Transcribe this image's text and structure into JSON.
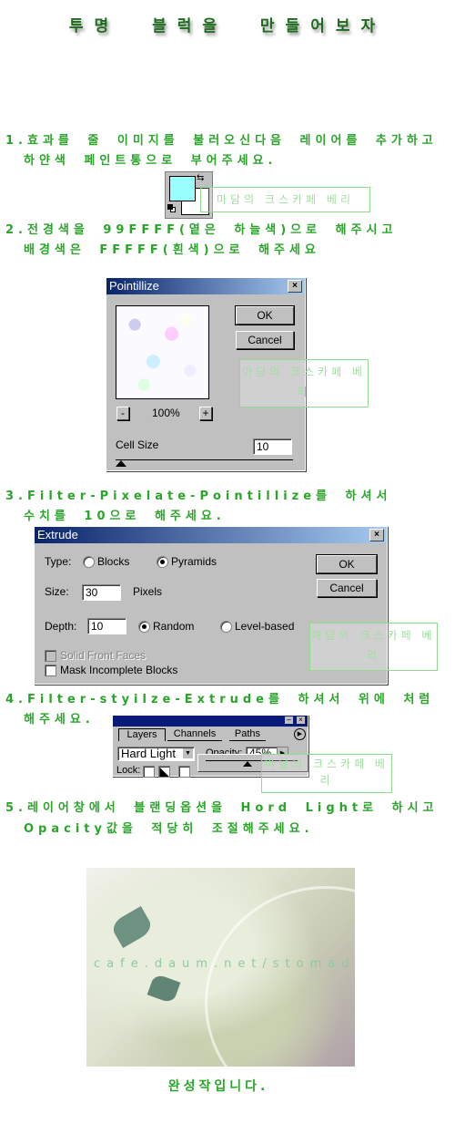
{
  "title": "투명 블럭을 만들어보자",
  "watermark": "마담의 크스카페 베리",
  "steps": [
    {
      "line1": "1.효과를 줄 이미지를 불러오신다음 레이어를 추가하고",
      "line2": "하얀색 페인트통으로 부어주세요."
    },
    {
      "line1": "2.전경색을 99FFFF(옅은 하늘색)으로 해주시고",
      "line2": "배경색은 FFFFF(흰색)으로 해주세요"
    },
    {
      "line1": "3.Filter-Pixelate-Pointillize를 하셔서",
      "line2": "수치를 10으로 해주세요."
    },
    {
      "line1": "4.Filter-styilze-Extrude를 하셔서 위에 처럼",
      "line2": "해주세요."
    },
    {
      "line1": "5.레이어창에서 블랜딩옵션을 Hord Light로 하시고",
      "line2": "Opacity값을 적당히 조절해주세요."
    }
  ],
  "colors": {
    "foreground": "#99FFFF",
    "background": "#FFFFFF",
    "text": "#2AA52A",
    "title": "#1E6B1E"
  },
  "pointillize": {
    "title": "Pointillize",
    "ok": "OK",
    "cancel": "Cancel",
    "zoom": "100%",
    "zoom_out": "-",
    "zoom_in": "+",
    "cell_size_label": "Cell Size",
    "cell_size": "10"
  },
  "extrude": {
    "title": "Extrude",
    "type_label": "Type:",
    "type_blocks": "Blocks",
    "type_pyramids": "Pyramids",
    "type_selected": "Pyramids",
    "size_label": "Size:",
    "size": "30",
    "size_unit": "Pixels",
    "depth_label": "Depth:",
    "depth": "10",
    "depth_random": "Random",
    "depth_level": "Level-based",
    "depth_selected": "Random",
    "solid_front": "Solid Front Faces",
    "mask_incomplete": "Mask Incomplete Blocks",
    "ok": "OK",
    "cancel": "Cancel"
  },
  "layers": {
    "tabs": [
      "Layers",
      "Channels",
      "Paths"
    ],
    "blend_mode": "Hard Light",
    "opacity_label": "Opacity:",
    "opacity": "45%",
    "lock_label": "Lock:"
  },
  "result": {
    "photo_watermark": "cafe.daum.net/stomadam",
    "caption": "완성작입니다."
  }
}
